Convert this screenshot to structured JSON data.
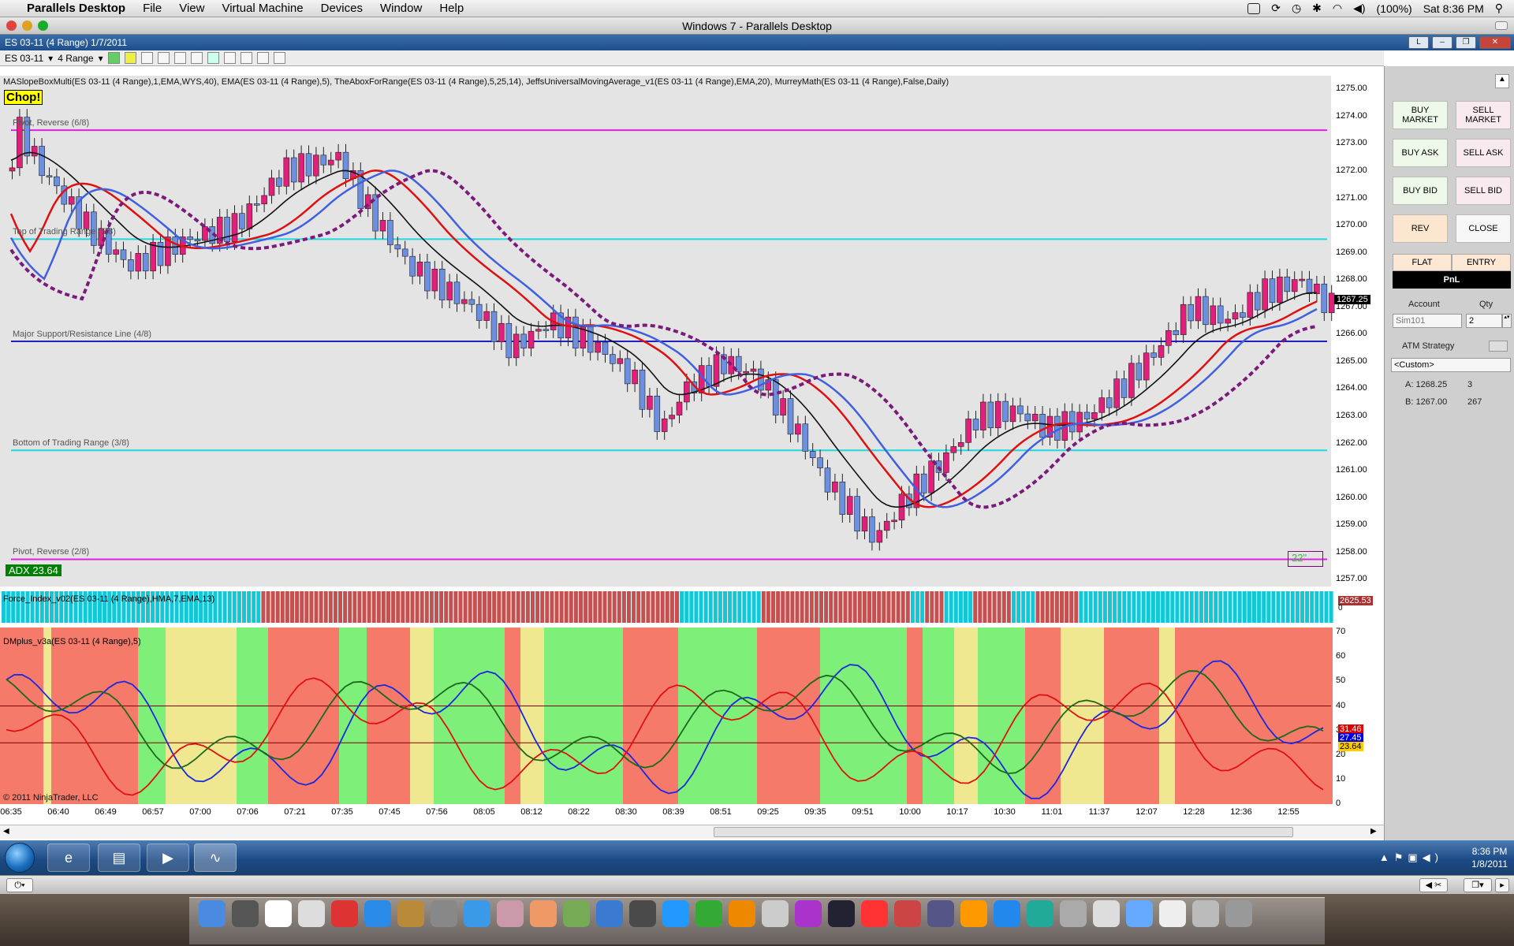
{
  "menubar": {
    "app": "Parallels Desktop",
    "items": [
      "File",
      "View",
      "Virtual Machine",
      "Devices",
      "Window",
      "Help"
    ],
    "battery": "(100%)",
    "clock": "Sat 8:36 PM"
  },
  "window_title": "Windows 7 - Parallels Desktop",
  "ninja": {
    "title": "ES 03-11 (4 Range)  1/7/2011",
    "instrument": "ES 03-11",
    "period": "4 Range",
    "title_btn": "L",
    "indicator_line": "MASlopeBoxMulti(ES 03-11 (4 Range),1,EMA,WYS,40), EMA(ES 03-11 (4 Range),5), TheAboxForRange(ES 03-11 (4 Range),5,25,14), JeffsUniversalMovingAverage_v1(ES 03-11 (4 Range),EMA,20), MurreyMath(ES 03-11 (4 Range),False,Daily)",
    "chop": "Chop!",
    "levels": [
      {
        "label": "Pivot, Reverse (6/8)",
        "price": 1273.5,
        "color": "#e020e0"
      },
      {
        "label": "Top of Trading Range (5/8)",
        "price": 1269.5,
        "color": "#20d8e0"
      },
      {
        "label": "Major Support/Resistance Line (4/8)",
        "price": 1265.75,
        "color": "#2020c0"
      },
      {
        "label": "Bottom of Trading Range (3/8)",
        "price": 1261.75,
        "color": "#20d8e0"
      },
      {
        "label": "Pivot, Reverse (2/8)",
        "price": 1257.75,
        "color": "#e020e0"
      }
    ],
    "adx": "ADX 23.64",
    "counter": "22\"",
    "price_axis": [
      "1275.00",
      "1274.00",
      "1273.00",
      "1272.00",
      "1271.00",
      "1270.00",
      "1269.00",
      "1268.00",
      "1267.00",
      "1266.00",
      "1265.00",
      "1264.00",
      "1263.00",
      "1262.00",
      "1261.00",
      "1260.00",
      "1259.00",
      "1258.00",
      "1257.00"
    ],
    "last_price": "1267.25",
    "force_label": "Force_Index_v02(ES 03-11 (4 Range),HMA,7,EMA,13)",
    "force_value": "2625.53",
    "force_zero": "0",
    "dm_label": "DMplus_v3a(ES 03-11 (4 Range),5)",
    "dm_axis": [
      "70",
      "60",
      "50",
      "40",
      "30",
      "20",
      "10",
      "0"
    ],
    "dm_values": [
      {
        "text": "31.46",
        "color": "#e00000"
      },
      {
        "text": "27.45",
        "color": "#0000e0"
      },
      {
        "text": "23.64",
        "color": "#ffcc00"
      }
    ],
    "copyright": "© 2011 NinjaTrader, LLC",
    "time_axis": [
      "06:35",
      "06:40",
      "06:49",
      "06:57",
      "07:00",
      "07:06",
      "07:21",
      "07:35",
      "07:45",
      "07:56",
      "08:05",
      "08:12",
      "08:22",
      "08:30",
      "08:39",
      "08:51",
      "09:25",
      "09:35",
      "09:51",
      "10:00",
      "10:17",
      "10:30",
      "11:01",
      "11:37",
      "12:07",
      "12:28",
      "12:36",
      "12:55"
    ]
  },
  "side_panel": {
    "buy_market": "BUY MARKET",
    "sell_market": "SELL MARKET",
    "buy_ask": "BUY ASK",
    "sell_ask": "SELL ASK",
    "buy_bid": "BUY BID",
    "sell_bid": "SELL BID",
    "rev": "REV",
    "close": "CLOSE",
    "flat": "FLAT",
    "entry": "ENTRY",
    "pnl": "PnL",
    "account_label": "Account",
    "qty_label": "Qty",
    "account": "Sim101",
    "qty": "2",
    "atm_label": "ATM Strategy",
    "atm_value": "<Custom>",
    "ask_line": "A: 1268.25",
    "ask_size": "3",
    "bid_line": "B: 1267.00",
    "bid_size": "267"
  },
  "taskbar": {
    "time": "8:36 PM",
    "date": "1/8/2011"
  }
}
